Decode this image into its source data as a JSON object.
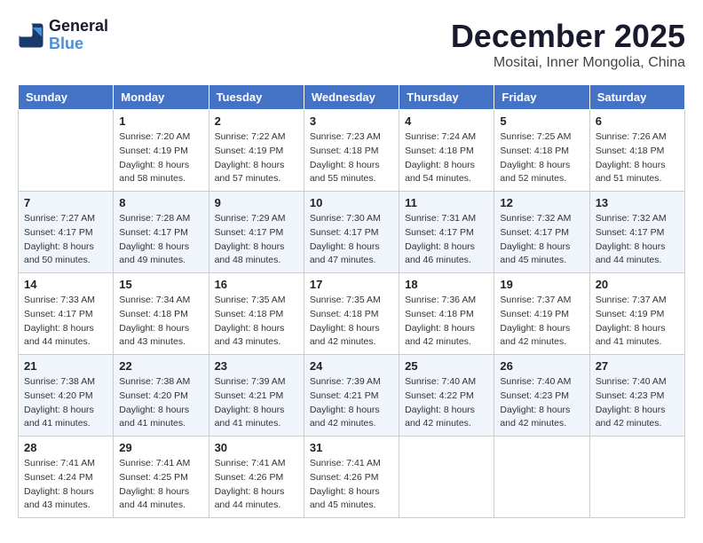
{
  "app": {
    "name": "GeneralBlue",
    "logo_color": "Blue"
  },
  "header": {
    "month": "December 2025",
    "location": "Mositai, Inner Mongolia, China"
  },
  "weekdays": [
    "Sunday",
    "Monday",
    "Tuesday",
    "Wednesday",
    "Thursday",
    "Friday",
    "Saturday"
  ],
  "weeks": [
    [
      {
        "day": "",
        "empty": true
      },
      {
        "day": "1",
        "sunrise": "7:20 AM",
        "sunset": "4:19 PM",
        "daylight": "8 hours and 58 minutes."
      },
      {
        "day": "2",
        "sunrise": "7:22 AM",
        "sunset": "4:19 PM",
        "daylight": "8 hours and 57 minutes."
      },
      {
        "day": "3",
        "sunrise": "7:23 AM",
        "sunset": "4:18 PM",
        "daylight": "8 hours and 55 minutes."
      },
      {
        "day": "4",
        "sunrise": "7:24 AM",
        "sunset": "4:18 PM",
        "daylight": "8 hours and 54 minutes."
      },
      {
        "day": "5",
        "sunrise": "7:25 AM",
        "sunset": "4:18 PM",
        "daylight": "8 hours and 52 minutes."
      },
      {
        "day": "6",
        "sunrise": "7:26 AM",
        "sunset": "4:18 PM",
        "daylight": "8 hours and 51 minutes."
      }
    ],
    [
      {
        "day": "7",
        "sunrise": "7:27 AM",
        "sunset": "4:17 PM",
        "daylight": "8 hours and 50 minutes."
      },
      {
        "day": "8",
        "sunrise": "7:28 AM",
        "sunset": "4:17 PM",
        "daylight": "8 hours and 49 minutes."
      },
      {
        "day": "9",
        "sunrise": "7:29 AM",
        "sunset": "4:17 PM",
        "daylight": "8 hours and 48 minutes."
      },
      {
        "day": "10",
        "sunrise": "7:30 AM",
        "sunset": "4:17 PM",
        "daylight": "8 hours and 47 minutes."
      },
      {
        "day": "11",
        "sunrise": "7:31 AM",
        "sunset": "4:17 PM",
        "daylight": "8 hours and 46 minutes."
      },
      {
        "day": "12",
        "sunrise": "7:32 AM",
        "sunset": "4:17 PM",
        "daylight": "8 hours and 45 minutes."
      },
      {
        "day": "13",
        "sunrise": "7:32 AM",
        "sunset": "4:17 PM",
        "daylight": "8 hours and 44 minutes."
      }
    ],
    [
      {
        "day": "14",
        "sunrise": "7:33 AM",
        "sunset": "4:17 PM",
        "daylight": "8 hours and 44 minutes."
      },
      {
        "day": "15",
        "sunrise": "7:34 AM",
        "sunset": "4:18 PM",
        "daylight": "8 hours and 43 minutes."
      },
      {
        "day": "16",
        "sunrise": "7:35 AM",
        "sunset": "4:18 PM",
        "daylight": "8 hours and 43 minutes."
      },
      {
        "day": "17",
        "sunrise": "7:35 AM",
        "sunset": "4:18 PM",
        "daylight": "8 hours and 42 minutes."
      },
      {
        "day": "18",
        "sunrise": "7:36 AM",
        "sunset": "4:18 PM",
        "daylight": "8 hours and 42 minutes."
      },
      {
        "day": "19",
        "sunrise": "7:37 AM",
        "sunset": "4:19 PM",
        "daylight": "8 hours and 42 minutes."
      },
      {
        "day": "20",
        "sunrise": "7:37 AM",
        "sunset": "4:19 PM",
        "daylight": "8 hours and 41 minutes."
      }
    ],
    [
      {
        "day": "21",
        "sunrise": "7:38 AM",
        "sunset": "4:20 PM",
        "daylight": "8 hours and 41 minutes."
      },
      {
        "day": "22",
        "sunrise": "7:38 AM",
        "sunset": "4:20 PM",
        "daylight": "8 hours and 41 minutes."
      },
      {
        "day": "23",
        "sunrise": "7:39 AM",
        "sunset": "4:21 PM",
        "daylight": "8 hours and 41 minutes."
      },
      {
        "day": "24",
        "sunrise": "7:39 AM",
        "sunset": "4:21 PM",
        "daylight": "8 hours and 42 minutes."
      },
      {
        "day": "25",
        "sunrise": "7:40 AM",
        "sunset": "4:22 PM",
        "daylight": "8 hours and 42 minutes."
      },
      {
        "day": "26",
        "sunrise": "7:40 AM",
        "sunset": "4:23 PM",
        "daylight": "8 hours and 42 minutes."
      },
      {
        "day": "27",
        "sunrise": "7:40 AM",
        "sunset": "4:23 PM",
        "daylight": "8 hours and 42 minutes."
      }
    ],
    [
      {
        "day": "28",
        "sunrise": "7:41 AM",
        "sunset": "4:24 PM",
        "daylight": "8 hours and 43 minutes."
      },
      {
        "day": "29",
        "sunrise": "7:41 AM",
        "sunset": "4:25 PM",
        "daylight": "8 hours and 44 minutes."
      },
      {
        "day": "30",
        "sunrise": "7:41 AM",
        "sunset": "4:26 PM",
        "daylight": "8 hours and 44 minutes."
      },
      {
        "day": "31",
        "sunrise": "7:41 AM",
        "sunset": "4:26 PM",
        "daylight": "8 hours and 45 minutes."
      },
      {
        "day": "",
        "empty": true
      },
      {
        "day": "",
        "empty": true
      },
      {
        "day": "",
        "empty": true
      }
    ]
  ]
}
